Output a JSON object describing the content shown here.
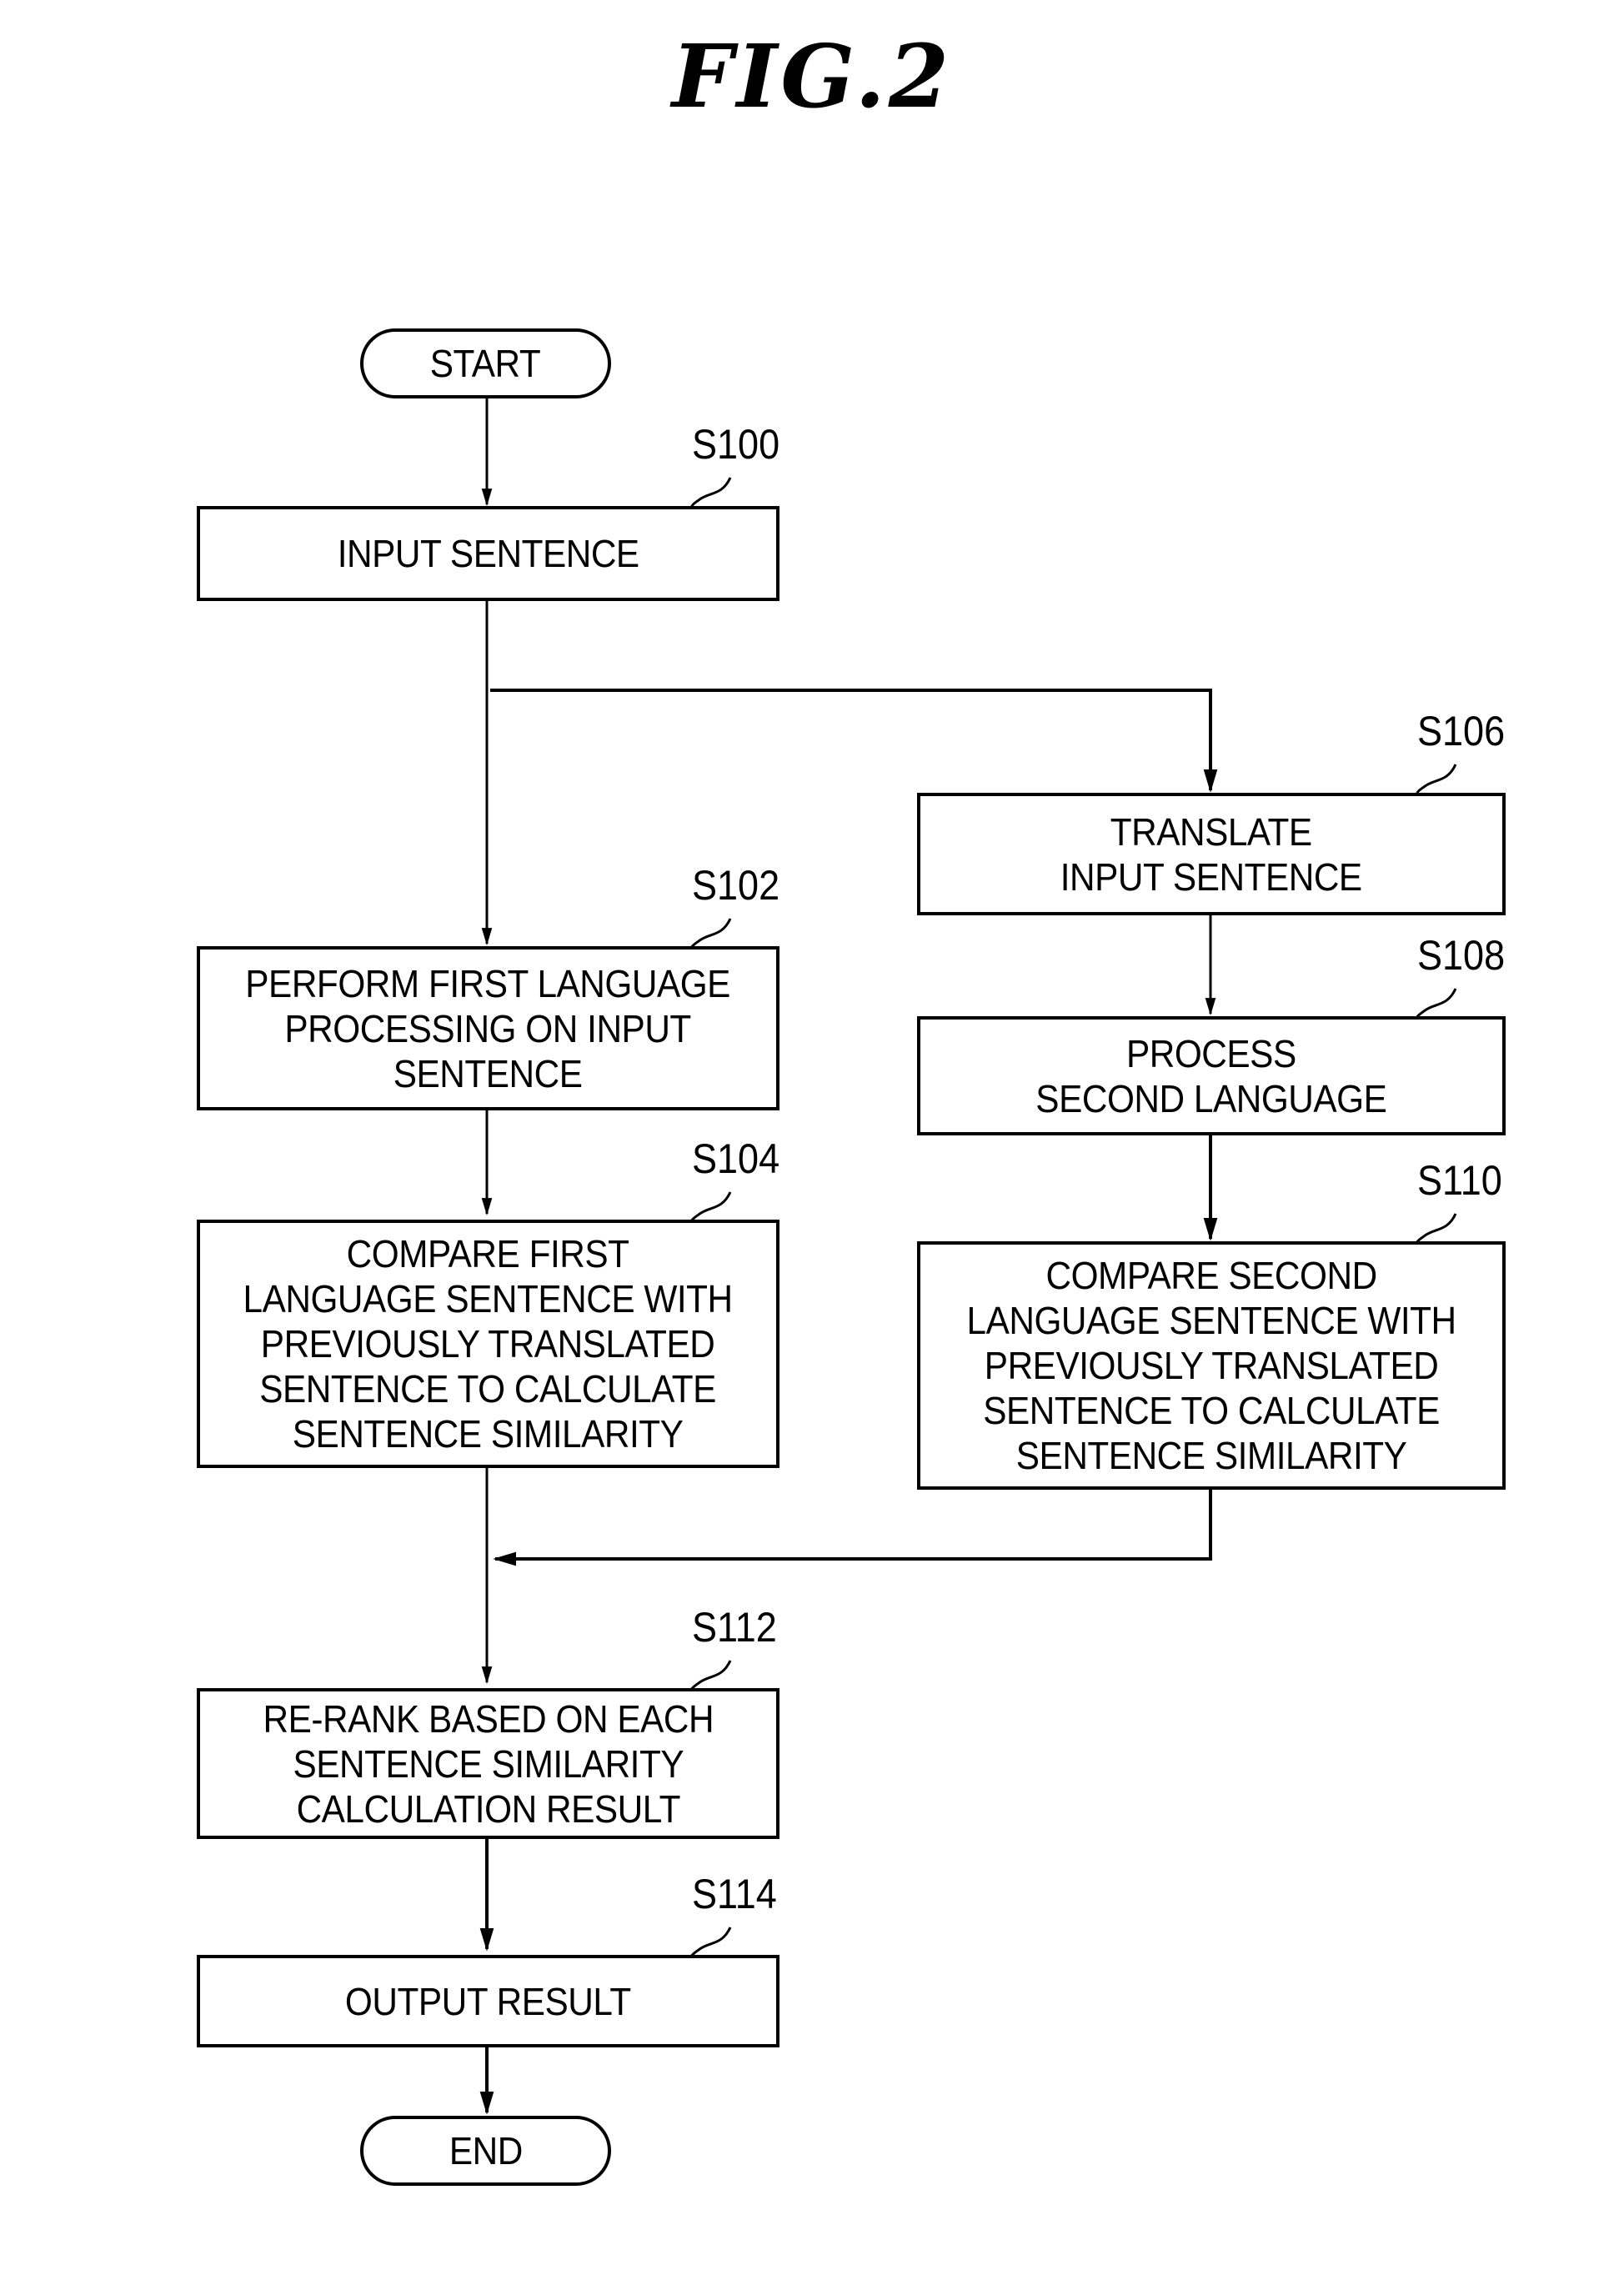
{
  "figure": {
    "title": "FIG.2"
  },
  "nodes": {
    "start": {
      "label": "START",
      "shape": "terminal"
    },
    "s100": {
      "step": "S100",
      "label": "INPUT SENTENCE",
      "shape": "process"
    },
    "s102": {
      "step": "S102",
      "label": "PERFORM FIRST LANGUAGE\nPROCESSING ON  INPUT\nSENTENCE",
      "shape": "process"
    },
    "s104": {
      "step": "S104",
      "label": "COMPARE FIRST\nLANGUAGE SENTENCE WITH\nPREVIOUSLY TRANSLATED\nSENTENCE TO CALCULATE\nSENTENCE SIMILARITY",
      "shape": "process"
    },
    "s106": {
      "step": "S106",
      "label": "TRANSLATE\nINPUT SENTENCE",
      "shape": "process"
    },
    "s108": {
      "step": "S108",
      "label": "PROCESS\nSECOND LANGUAGE",
      "shape": "process"
    },
    "s110": {
      "step": "S110",
      "label": "COMPARE SECOND\nLANGUAGE SENTENCE WITH\nPREVIOUSLY TRANSLATED\nSENTENCE TO CALCULATE\nSENTENCE SIMILARITY",
      "shape": "process"
    },
    "s112": {
      "step": "S112",
      "label": "RE-RANK BASED ON EACH\nSENTENCE SIMILARITY\nCALCULATION RESULT",
      "shape": "process"
    },
    "s114": {
      "step": "S114",
      "label": "OUTPUT RESULT",
      "shape": "process"
    },
    "end": {
      "label": "END",
      "shape": "terminal"
    }
  },
  "edges": [
    {
      "from": "start",
      "to": "s100"
    },
    {
      "from": "s100",
      "to": "s102"
    },
    {
      "from": "s100",
      "to": "s106"
    },
    {
      "from": "s102",
      "to": "s104"
    },
    {
      "from": "s106",
      "to": "s108"
    },
    {
      "from": "s108",
      "to": "s110"
    },
    {
      "from": "s104",
      "to": "s112"
    },
    {
      "from": "s110",
      "to": "s112"
    },
    {
      "from": "s112",
      "to": "s114"
    },
    {
      "from": "s114",
      "to": "end"
    }
  ],
  "colors": {
    "stroke": "#000000",
    "background": "#ffffff"
  }
}
